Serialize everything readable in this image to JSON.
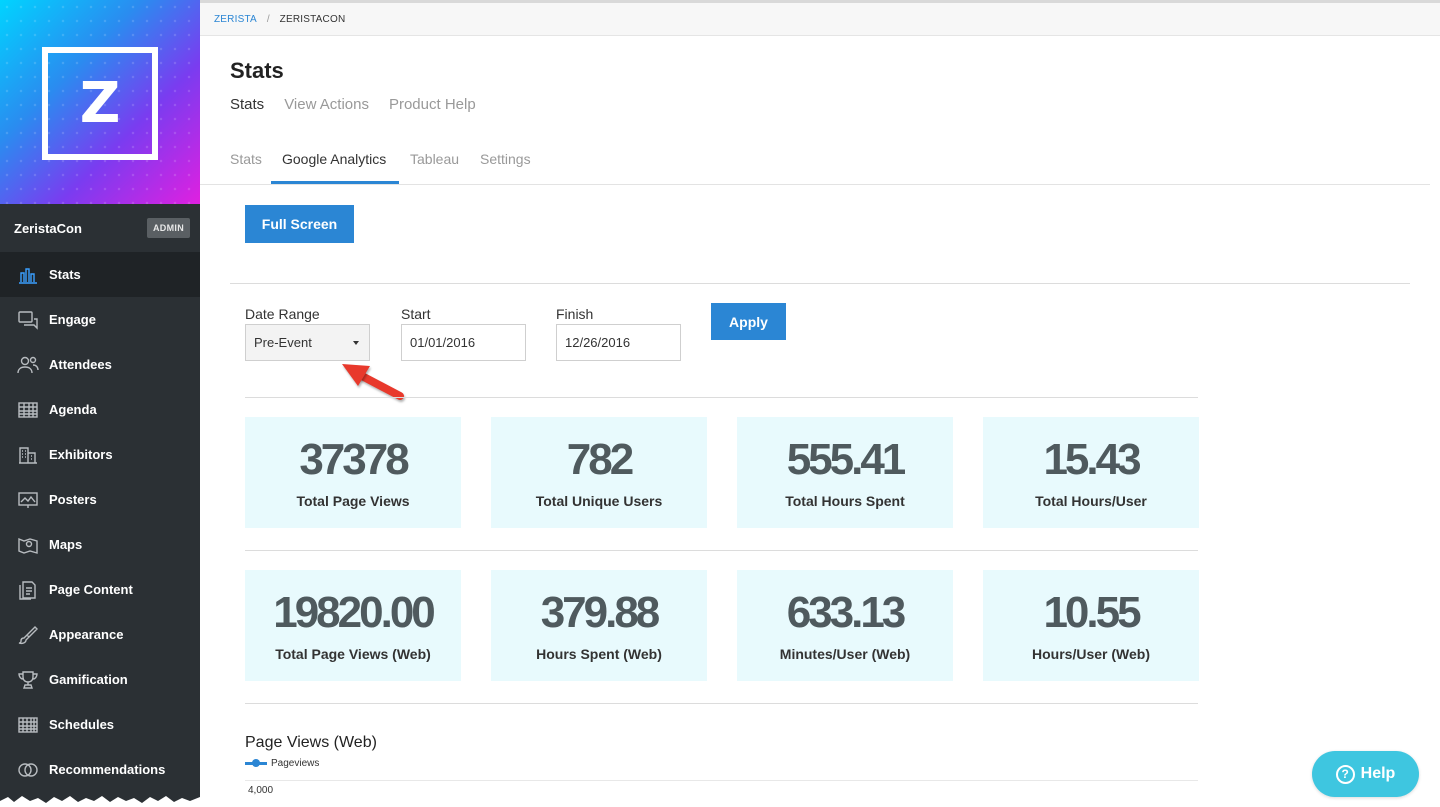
{
  "sidebar": {
    "logo_letter": "Z",
    "org_name": "ZeristaCon",
    "admin_badge": "ADMIN",
    "items": [
      {
        "label": "Stats",
        "icon": "bar-chart-icon",
        "active": true
      },
      {
        "label": "Engage",
        "icon": "chat-bubbles-icon"
      },
      {
        "label": "Attendees",
        "icon": "people-icon"
      },
      {
        "label": "Agenda",
        "icon": "calendar-grid-icon"
      },
      {
        "label": "Exhibitors",
        "icon": "building-icon"
      },
      {
        "label": "Posters",
        "icon": "presentation-board-icon"
      },
      {
        "label": "Maps",
        "icon": "map-icon"
      },
      {
        "label": "Page Content",
        "icon": "document-icon"
      },
      {
        "label": "Appearance",
        "icon": "paint-brush-icon"
      },
      {
        "label": "Gamification",
        "icon": "trophy-icon"
      },
      {
        "label": "Schedules",
        "icon": "schedule-grid-icon"
      },
      {
        "label": "Recommendations",
        "icon": "link-circles-icon"
      }
    ]
  },
  "breadcrumb": {
    "items": [
      "ZERISTA",
      "ZERISTACON"
    ],
    "separator": "/"
  },
  "header": {
    "title": "Stats",
    "sub_nav": [
      "Stats",
      "View Actions",
      "Product Help"
    ],
    "tabs": [
      "Stats",
      "Google Analytics",
      "Tableau",
      "Settings"
    ],
    "active_tab": "Google Analytics"
  },
  "toolbar": {
    "full_screen_label": "Full Screen"
  },
  "filters": {
    "date_range": {
      "label": "Date Range",
      "value": "Pre-Event"
    },
    "start": {
      "label": "Start",
      "value": "01/01/2016"
    },
    "finish": {
      "label": "Finish",
      "value": "12/26/2016"
    },
    "apply_label": "Apply"
  },
  "stats_row1": [
    {
      "value": "37378",
      "label": "Total Page Views"
    },
    {
      "value": "782",
      "label": "Total Unique Users"
    },
    {
      "value": "555.41",
      "label": "Total Hours Spent"
    },
    {
      "value": "15.43",
      "label": "Total Hours/User"
    }
  ],
  "stats_row2": [
    {
      "value": "19820.00",
      "label": "Total Page Views (Web)"
    },
    {
      "value": "379.88",
      "label": "Hours Spent (Web)"
    },
    {
      "value": "633.13",
      "label": "Minutes/User (Web)"
    },
    {
      "value": "10.55",
      "label": "Hours/User (Web)"
    }
  ],
  "chart": {
    "title": "Page Views (Web)",
    "legend": "Pageviews",
    "y_tick_top": "4,000"
  },
  "help": {
    "label": "Help",
    "icon_glyph": "?"
  },
  "colors": {
    "accent": "#2b86d4",
    "card_bg": "#e8fafd",
    "sidebar_bg": "#2b3034",
    "help": "#3ec6e0",
    "arrow": "#e8392c"
  }
}
